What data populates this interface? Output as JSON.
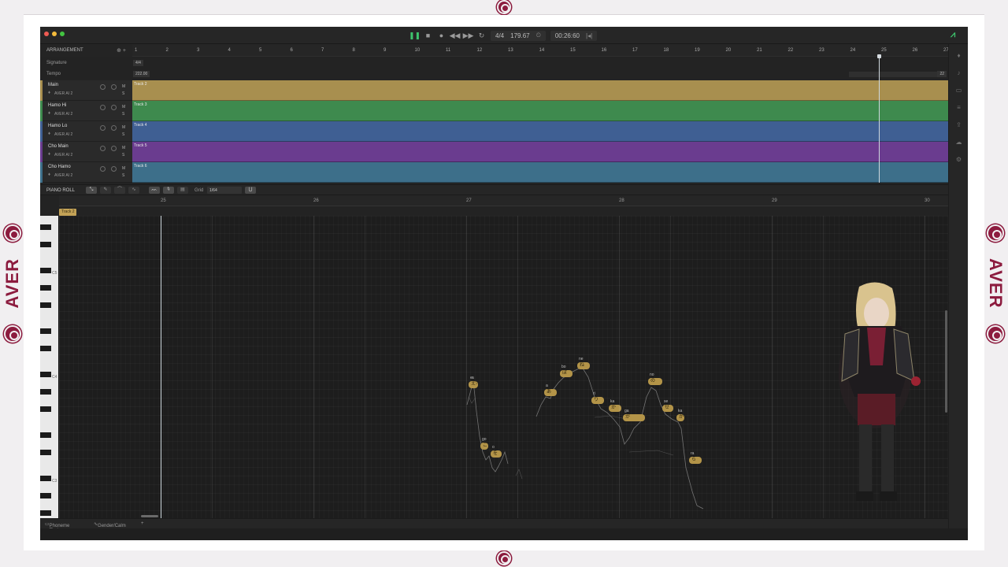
{
  "brand": {
    "word": "AVER"
  },
  "transport": {
    "time_signature": "4/4",
    "tempo": "179.67",
    "time": "00:26:60",
    "loop_marker": "|◂|"
  },
  "arrangement": {
    "title": "ARRANGEMENT",
    "signature_label": "Signature",
    "signature_value": "4/4",
    "tempo_label": "Tempo",
    "tempo_value": "222.00",
    "tempo_end": "22",
    "ruler": [
      "1",
      "2",
      "3",
      "4",
      "5",
      "6",
      "7",
      "8",
      "9",
      "10",
      "11",
      "12",
      "13",
      "14",
      "15",
      "16",
      "17",
      "18",
      "19",
      "20",
      "21",
      "22",
      "23",
      "24",
      "25",
      "26",
      "27"
    ],
    "tracks": [
      {
        "name": "Main",
        "voice": "AVER AI 2",
        "clip": "Track 2",
        "color": "#a88f4f"
      },
      {
        "name": "Hamo Hi",
        "voice": "AVER AI 2",
        "clip": "Track 3",
        "color": "#3e8a4e"
      },
      {
        "name": "Hamo Lo",
        "voice": "AVER AI 2",
        "clip": "Track 4",
        "color": "#3f5f93"
      },
      {
        "name": "Cho Main",
        "voice": "AVER AI 2",
        "clip": "Track 5",
        "color": "#6a3c8f"
      },
      {
        "name": "Cho Hamo",
        "voice": "AVER AI 2",
        "clip": "Track 6",
        "color": "#3d6f8a"
      }
    ]
  },
  "piano_roll": {
    "title": "PIANO ROLL",
    "grid_label": "Grid",
    "grid_value": "1/64",
    "clip_tag": "Track 2",
    "ruler": [
      "25",
      "26",
      "27",
      "28",
      "29",
      "30"
    ],
    "key_labels": [
      "C5",
      "C4",
      "C3"
    ],
    "notes": [
      {
        "phoneme": "あ",
        "lyric": "a"
      },
      {
        "phoneme": "ご",
        "lyric": "go"
      },
      {
        "phoneme": "を",
        "lyric": "o"
      },
      {
        "phoneme": "あ",
        "lyric": "a"
      },
      {
        "phoneme": "ぼ",
        "lyric": "bo"
      },
      {
        "phoneme": "ね",
        "lyric": "ne"
      },
      {
        "phoneme": "り",
        "lyric": "ri"
      },
      {
        "phoneme": "か",
        "lyric": "ka"
      },
      {
        "phoneme": "が",
        "lyric": "ga"
      },
      {
        "phoneme": "の",
        "lyric": "no"
      },
      {
        "phoneme": "せ",
        "lyric": "se"
      },
      {
        "phoneme": "か",
        "lyric": "ka"
      },
      {
        "phoneme": "ら",
        "lyric": "ra"
      },
      {
        "phoneme": "え",
        "lyric": "e"
      }
    ]
  },
  "bottom_tabs": {
    "phoneme_timing": "Phoneme Timing",
    "gender_calm": "Gender/Calm",
    "add": "+"
  },
  "colors": {
    "brand": "#8c1b3e",
    "play": "#3ec46d",
    "note": "#b39448"
  },
  "icons": [
    "play-icon",
    "stop-icon",
    "record-icon",
    "rewind-icon",
    "fast-forward-icon",
    "loop-icon",
    "metronome-icon",
    "mic-icon",
    "settings-icon"
  ]
}
